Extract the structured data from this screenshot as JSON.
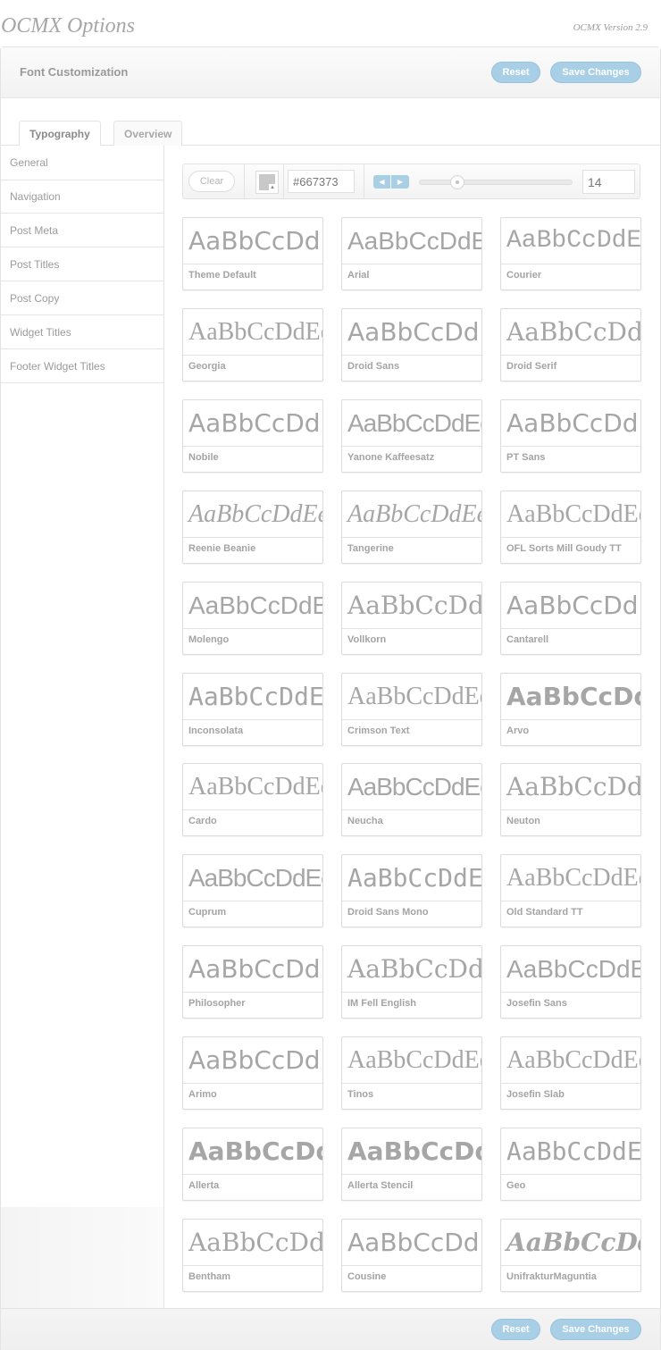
{
  "app": {
    "title": "OCMX Options",
    "version": "OCMX Version 2.9"
  },
  "header": {
    "title": "Font Customization",
    "reset_label": "Reset",
    "save_label": "Save Changes"
  },
  "tabs": [
    {
      "label": "Typography",
      "active": true
    },
    {
      "label": "Overview",
      "active": false
    }
  ],
  "sidebar": {
    "items": [
      {
        "label": "General",
        "active": true
      },
      {
        "label": "Navigation"
      },
      {
        "label": "Post Meta"
      },
      {
        "label": "Post Titles"
      },
      {
        "label": "Post Copy"
      },
      {
        "label": "Widget Titles"
      },
      {
        "label": "Footer Widget Titles"
      }
    ]
  },
  "toolbar": {
    "clear_label": "Clear",
    "color_value": "#667373",
    "swatch_color": "#c8c8c8",
    "font_size": "14",
    "slider_fraction": 0.22
  },
  "fonts": [
    {
      "preview": "AaBbCcDdEeFfGg",
      "name": "Theme Default",
      "style": "f-sans"
    },
    {
      "preview": "AaBbCcDdEeFfGg",
      "name": "Arial",
      "style": "f-thin"
    },
    {
      "preview": "AaBbCcDdEeFfGg",
      "name": "Courier",
      "style": "f-mono"
    },
    {
      "preview": "AaBbCcDdEeFfGg",
      "name": "Georgia",
      "style": "f-lserif"
    },
    {
      "preview": "AaBbCcDdEeFfGg",
      "name": "Droid Sans",
      "style": "f-sans"
    },
    {
      "preview": "AaBbCcDdEeFfGg",
      "name": "Droid Serif",
      "style": "f-serif"
    },
    {
      "preview": "AaBbCcDdEeFfGg",
      "name": "Nobile",
      "style": "f-sans"
    },
    {
      "preview": "AaBbCcDdEeFfGg",
      "name": "Yanone Kaffeesatz",
      "style": "f-condensed"
    },
    {
      "preview": "AaBbCcDdEeFfGg",
      "name": "PT Sans",
      "style": "f-sans"
    },
    {
      "preview": "AaBbCcDdEeFfGg",
      "name": "Reenie Beanie",
      "style": "f-script"
    },
    {
      "preview": "AaBbCcDdEeFfGg",
      "name": "Tangerine",
      "style": "f-script"
    },
    {
      "preview": "AaBbCcDdEeFfGg",
      "name": "OFL Sorts Mill Goudy TT",
      "style": "f-lserif"
    },
    {
      "preview": "AaBbCcDdEeFfGg",
      "name": "Molengo",
      "style": "f-thin"
    },
    {
      "preview": "AaBbCcDdEeFfGg",
      "name": "Vollkorn",
      "style": "f-serif"
    },
    {
      "preview": "AaBbCcDdEeFfGg",
      "name": "Cantarell",
      "style": "f-sans"
    },
    {
      "preview": "AaBbCcDdEeFfGg",
      "name": "Inconsolata",
      "style": "f-dmono"
    },
    {
      "preview": "AaBbCcDdEeFfGg",
      "name": "Crimson Text",
      "style": "f-lserif"
    },
    {
      "preview": "AaBbCcDdEeFfGg",
      "name": "Arvo",
      "style": "f-bold"
    },
    {
      "preview": "AaBbCcDdEeFfGg",
      "name": "Cardo",
      "style": "f-lserif"
    },
    {
      "preview": "AaBbCcDdEeFfGg",
      "name": "Neucha",
      "style": "f-condensed"
    },
    {
      "preview": "AaBbCcDdEeFfGg",
      "name": "Neuton",
      "style": "f-serif"
    },
    {
      "preview": "AaBbCcDdEeFfGg",
      "name": "Cuprum",
      "style": "f-condensed"
    },
    {
      "preview": "AaBbCcDdEeFfGg",
      "name": "Droid Sans Mono",
      "style": "f-dmono"
    },
    {
      "preview": "AaBbCcDdEeFfGg",
      "name": "Old Standard TT",
      "style": "f-lserif"
    },
    {
      "preview": "AaBbCcDdEeFfGg",
      "name": "Philosopher",
      "style": "f-sans"
    },
    {
      "preview": "AaBbCcDdEeFfGg",
      "name": "IM Fell English",
      "style": "f-serif"
    },
    {
      "preview": "AaBbCcDdEeFfGg",
      "name": "Josefin Sans",
      "style": "f-thin"
    },
    {
      "preview": "AaBbCcDdEeFfGg",
      "name": "Arimo",
      "style": "f-sans"
    },
    {
      "preview": "AaBbCcDdEeFfGg",
      "name": "Tinos",
      "style": "f-lserif"
    },
    {
      "preview": "AaBbCcDdEeFfGg",
      "name": "Josefin Slab",
      "style": "f-lserif"
    },
    {
      "preview": "AaBbCcDdEeFfGg",
      "name": "Allerta",
      "style": "f-bold"
    },
    {
      "preview": "AaBbCcDdEeFfGg",
      "name": "Allerta Stencil",
      "style": "f-bold"
    },
    {
      "preview": "AaBbCcDdEeFfGg",
      "name": "Geo",
      "style": "f-dmono"
    },
    {
      "preview": "AaBbCcDdEeFfGg",
      "name": "Bentham",
      "style": "f-serif"
    },
    {
      "preview": "AaBbCcDdEeFfGg",
      "name": "Cousine",
      "style": "f-sans"
    },
    {
      "preview": "AaBbCcDdEeFfGg",
      "name": "UnifrakturMaguntia",
      "style": "f-gothic"
    }
  ],
  "footer": {
    "reset_label": "Reset",
    "save_label": "Save Changes"
  }
}
